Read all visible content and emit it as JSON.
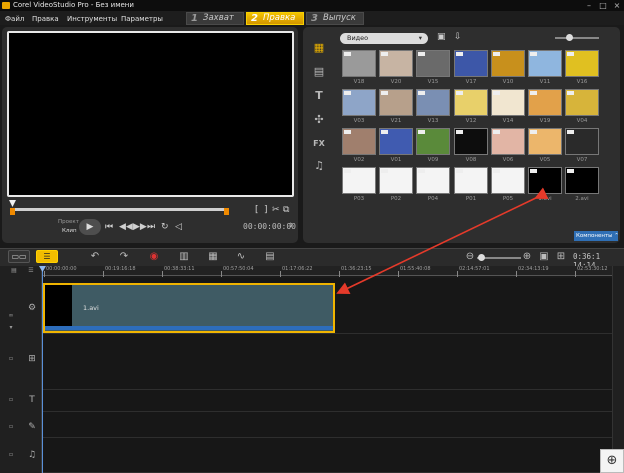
{
  "window": {
    "title": "Corel VideoStudio Pro - Без имени",
    "min": "–",
    "max": "□",
    "close": "×"
  },
  "menu": [
    "Файл",
    "Правка",
    "Инструменты",
    "Параметры"
  ],
  "steps": [
    {
      "num": "1",
      "label": "Захват"
    },
    {
      "num": "2",
      "label": "Правка"
    },
    {
      "num": "3",
      "label": "Выпуск"
    }
  ],
  "active_step": "Правка",
  "preview": {
    "mode_project": "Проект",
    "mode_clip": "Клип",
    "timecode": "00:00:00:00",
    "bracket_in": "[",
    "bracket_out": "]"
  },
  "library": {
    "dropdown": "Видео",
    "components_button": "Компоненты",
    "rows": [
      [
        {
          "label": "V18",
          "bg": "#9a9a9a"
        },
        {
          "label": "V20",
          "bg": "#c7b4a3"
        },
        {
          "label": "V15",
          "bg": "#6a6a6a"
        },
        {
          "label": "V17",
          "bg": "#3d57a8"
        },
        {
          "label": "V10",
          "bg": "#c8901c"
        },
        {
          "label": "V11",
          "bg": "#8fb6df"
        },
        {
          "label": "V16",
          "bg": "#e0c021"
        }
      ],
      [
        {
          "label": "V03",
          "bg": "#8ea5c8"
        },
        {
          "label": "V21",
          "bg": "#b7a08b"
        },
        {
          "label": "V13",
          "bg": "#7a8fb3"
        },
        {
          "label": "V12",
          "bg": "#e8d06a"
        },
        {
          "label": "V14",
          "bg": "#f1e6d0"
        },
        {
          "label": "V19",
          "bg": "#e2a14a"
        },
        {
          "label": "V04",
          "bg": "#d7b43a"
        }
      ],
      [
        {
          "label": "V02",
          "bg": "#a07f6d"
        },
        {
          "label": "V01",
          "bg": "#405bb0"
        },
        {
          "label": "V09",
          "bg": "#5a8a3a"
        },
        {
          "label": "V08",
          "bg": "#0d0d0d"
        },
        {
          "label": "V06",
          "bg": "#e2b5a5"
        },
        {
          "label": "V05",
          "bg": "#ecb66b"
        },
        {
          "label": "V07",
          "bg": "#2a2a2a"
        }
      ],
      [
        {
          "label": "P03",
          "bg": "#f4f4f4"
        },
        {
          "label": "P02",
          "bg": "#f4f4f4"
        },
        {
          "label": "P04",
          "bg": "#f4f4f4"
        },
        {
          "label": "P01",
          "bg": "#f4f4f4"
        },
        {
          "label": "P05",
          "bg": "#f4f4f4"
        },
        {
          "label": "1.avi",
          "bg": "#000000"
        },
        {
          "label": "2.avi",
          "bg": "#000000"
        }
      ]
    ],
    "sidebar_icons": [
      "media-folder-icon",
      "instant-project-icon",
      "title-icon",
      "graphic-icon",
      "filter-fx-icon",
      "audio-icon"
    ],
    "sidebar_glyphs": [
      "▦",
      "▤",
      "T",
      "✣",
      "FX",
      "♫"
    ]
  },
  "timeline": {
    "timecode": "0:36:1 14:14",
    "ruler_labels": [
      "00:00:00:00",
      "00:19:16:18",
      "00:38:33:11",
      "00:57:50:04",
      "01:17:06:22",
      "01:36:23:15",
      "01:55:40:08",
      "02:14:57:01",
      "02:34:13:19",
      "02:53:30:12"
    ],
    "clip_name": "1.avi",
    "toolbar_icons": [
      "storyboard-view-icon",
      "timeline-view-icon",
      "undo-icon",
      "redo-icon",
      "record-capture-icon",
      "mixer-icon",
      "auto-music-icon",
      "zoom-out-icon",
      "zoom-in-icon",
      "fit-project-icon"
    ]
  },
  "colors": {
    "accent": "#f2bd00",
    "annotation_arrow": "#e53a2a",
    "clip_fill": "#3f5b64",
    "audio_bar": "#2d6dbb"
  }
}
